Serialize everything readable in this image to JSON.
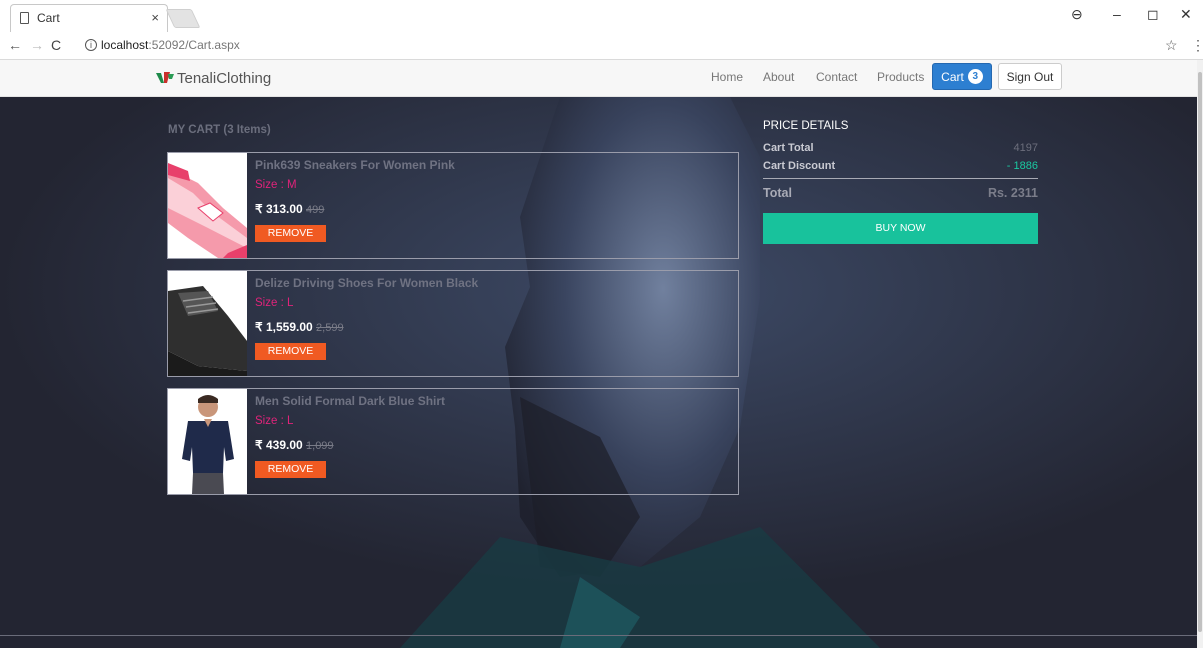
{
  "browser": {
    "tab_title": "Cart",
    "tab_close": "×",
    "url_host": "localhost",
    "url_rest": ":52092/Cart.aspx",
    "back": "←",
    "forward": "→",
    "reload": "C",
    "star": "☆",
    "menu": "⋮",
    "win_min": "–",
    "win_max": "◻",
    "win_close": "✕",
    "profile": "⊖"
  },
  "navbar": {
    "brand": "TenaliClothing",
    "links": [
      "Home",
      "About",
      "Contact",
      "Products"
    ],
    "cart_label": "Cart",
    "cart_count": "3",
    "signout_label": "Sign Out"
  },
  "cart": {
    "heading": "MY CART (3 Items)",
    "items": [
      {
        "name": "Pink639 Sneakers For Women Pink",
        "size": "Size : M",
        "price": "₹ 313.00",
        "mrp": "499",
        "remove": "REMOVE"
      },
      {
        "name": "Delize Driving Shoes For Women Black",
        "size": "Size : L",
        "price": "₹ 1,559.00",
        "mrp": "2,599",
        "remove": "REMOVE"
      },
      {
        "name": "Men Solid Formal Dark Blue Shirt",
        "size": "Size : L",
        "price": "₹ 439.00",
        "mrp": "1,099",
        "remove": "REMOVE"
      }
    ]
  },
  "price_details": {
    "title": "PRICE DETAILS",
    "cart_total_label": "Cart Total",
    "cart_total_value": "4197",
    "discount_label": "Cart Discount",
    "discount_value": "- 1886",
    "total_label": "Total",
    "total_value": "Rs. 2311",
    "buy_now": "BUY NOW"
  },
  "colors": {
    "accent_blue": "#2d7fd1",
    "buy_green": "#18c29c",
    "remove_orange": "#f05a22",
    "size_pink": "#e0237a",
    "page_bg": "#262835"
  }
}
